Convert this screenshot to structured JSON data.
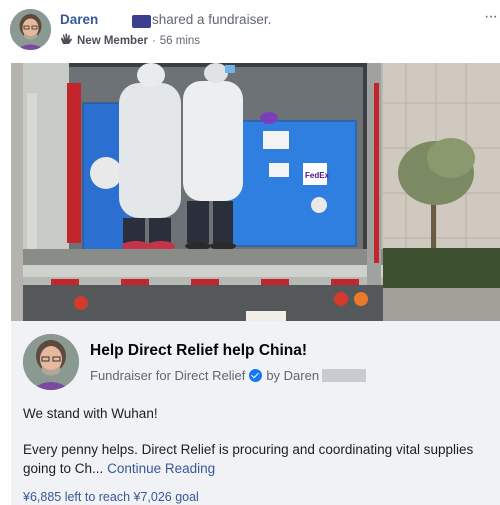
{
  "post": {
    "author": "Daren",
    "action": "shared a fundraiser.",
    "badge": "New Member",
    "separator": "·",
    "time": "56 mins",
    "more": "···"
  },
  "fundraiser": {
    "title": "Help Direct Relief help China!",
    "subtitle": "Fundraiser for Direct Relief",
    "by_label": "by Daren",
    "line1": "We stand with Wuhan!",
    "body": "Every penny helps. Direct Relief is procuring and coordinating vital supplies going to Ch...",
    "continue": "Continue Reading",
    "goal": "¥6,885 left to reach ¥7,026 goal"
  },
  "photo": {
    "box_label": "FedEx"
  },
  "colors": {
    "link": "#385898",
    "card_bg": "#f0f2f5",
    "verified": "#1877f2"
  }
}
